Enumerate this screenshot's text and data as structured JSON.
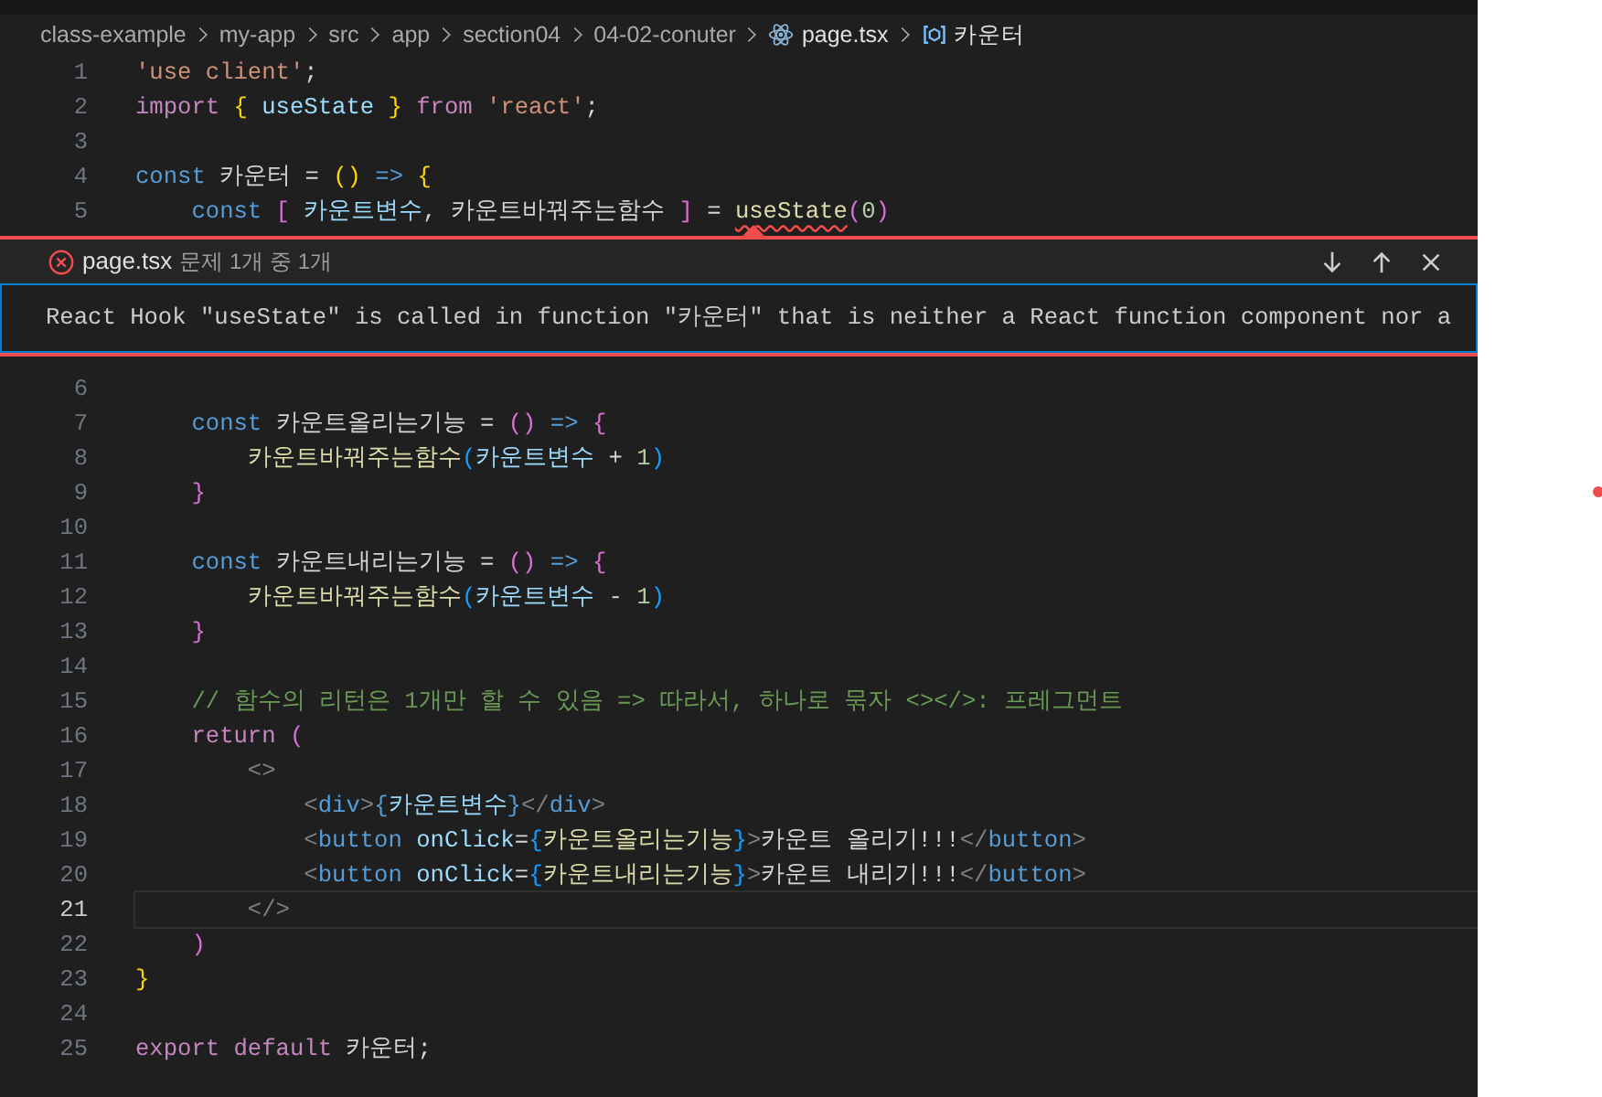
{
  "breadcrumb": [
    {
      "label": "class-example",
      "kind": "folder"
    },
    {
      "label": "my-app",
      "kind": "folder"
    },
    {
      "label": "src",
      "kind": "folder"
    },
    {
      "label": "app",
      "kind": "folder"
    },
    {
      "label": "section04",
      "kind": "folder"
    },
    {
      "label": "04-02-conuter",
      "kind": "folder"
    },
    {
      "label": "page.tsx",
      "kind": "file"
    },
    {
      "label": "카운터",
      "kind": "symbol"
    }
  ],
  "lines_before": [
    {
      "number": "1",
      "active": false,
      "tokens": [
        {
          "kind": "str",
          "text": "'use client'"
        },
        {
          "kind": "plain",
          "text": ";"
        }
      ]
    },
    {
      "number": "2",
      "active": false,
      "tokens": [
        {
          "kind": "ctl",
          "text": "import "
        },
        {
          "kind": "b1",
          "text": "{ "
        },
        {
          "kind": "var",
          "text": "useState "
        },
        {
          "kind": "b1",
          "text": "} "
        },
        {
          "kind": "ctl",
          "text": "from "
        },
        {
          "kind": "str",
          "text": "'react'"
        },
        {
          "kind": "plain",
          "text": ";"
        }
      ]
    },
    {
      "number": "3",
      "active": false
    },
    {
      "number": "4",
      "active": false,
      "tokens": [
        {
          "kind": "kw",
          "text": "const"
        },
        {
          "kind": "plain",
          "text": " 카운터 = "
        },
        {
          "kind": "b1",
          "text": "() "
        },
        {
          "kind": "kw",
          "text": "=> "
        },
        {
          "kind": "b1",
          "text": "{"
        }
      ]
    },
    {
      "number": "5",
      "active": false,
      "tokens": [
        {
          "kind": "kw",
          "text": "    const "
        },
        {
          "kind": "b2",
          "text": "[ "
        },
        {
          "kind": "var",
          "text": "카운트변수"
        },
        {
          "kind": "plain",
          "text": ", 카운트바꿔주는함수 "
        },
        {
          "kind": "b2",
          "text": "]"
        },
        {
          "kind": "plain",
          "text": " = "
        },
        {
          "kind": "err",
          "text": "useState"
        },
        {
          "kind": "b2",
          "text": "("
        },
        {
          "kind": "num",
          "text": "0"
        },
        {
          "kind": "b2",
          "text": ")"
        }
      ]
    }
  ],
  "problem": {
    "file": "page.tsx",
    "count": "문제 1개 중 1개",
    "message": "React Hook \"useState\" is called in function \"카운터\" that is neither a React function component nor a"
  },
  "lines_after": [
    {
      "number": "6",
      "active": false
    },
    {
      "number": "7",
      "active": false,
      "tokens": [
        {
          "kind": "kw",
          "text": "    const"
        },
        {
          "kind": "plain",
          "text": " 카운트올리는기능 = "
        },
        {
          "kind": "b2",
          "text": "() "
        },
        {
          "kind": "kw",
          "text": "=> "
        },
        {
          "kind": "b2",
          "text": "{"
        }
      ]
    },
    {
      "number": "8",
      "active": false,
      "tokens": [
        {
          "kind": "fn",
          "text": "        카운트바꿔주는함수"
        },
        {
          "kind": "b3",
          "text": "("
        },
        {
          "kind": "var",
          "text": "카운트변수"
        },
        {
          "kind": "plain",
          "text": " + "
        },
        {
          "kind": "num",
          "text": "1"
        },
        {
          "kind": "b3",
          "text": ")"
        }
      ]
    },
    {
      "number": "9",
      "active": false,
      "tokens": [
        {
          "kind": "b2",
          "text": "    }"
        }
      ]
    },
    {
      "number": "10",
      "active": false
    },
    {
      "number": "11",
      "active": false,
      "tokens": [
        {
          "kind": "kw",
          "text": "    const"
        },
        {
          "kind": "plain",
          "text": " 카운트내리는기능 = "
        },
        {
          "kind": "b2",
          "text": "() "
        },
        {
          "kind": "kw",
          "text": "=> "
        },
        {
          "kind": "b2",
          "text": "{"
        }
      ]
    },
    {
      "number": "12",
      "active": false,
      "tokens": [
        {
          "kind": "fn",
          "text": "        카운트바꿔주는함수"
        },
        {
          "kind": "b3",
          "text": "("
        },
        {
          "kind": "var",
          "text": "카운트변수"
        },
        {
          "kind": "plain",
          "text": " - "
        },
        {
          "kind": "num",
          "text": "1"
        },
        {
          "kind": "b3",
          "text": ")"
        }
      ]
    },
    {
      "number": "13",
      "active": false,
      "tokens": [
        {
          "kind": "b2",
          "text": "    }"
        }
      ]
    },
    {
      "number": "14",
      "active": false
    },
    {
      "number": "15",
      "active": false,
      "tokens": [
        {
          "kind": "comment",
          "text": "    // 함수의 리턴은 1개만 할 수 있음 => 따라서, 하나로 묶자 <></>: 프레그먼트"
        }
      ]
    },
    {
      "number": "16",
      "active": false,
      "tokens": [
        {
          "kind": "ctl",
          "text": "    return "
        },
        {
          "kind": "b2",
          "text": "("
        }
      ]
    },
    {
      "number": "17",
      "active": false,
      "tokens": [
        {
          "kind": "punct",
          "text": "        <>"
        }
      ]
    },
    {
      "number": "18",
      "active": false,
      "tokens": [
        {
          "kind": "punct",
          "text": "            <"
        },
        {
          "kind": "kw",
          "text": "div"
        },
        {
          "kind": "punct",
          "text": ">"
        },
        {
          "kind": "kw",
          "text": "{"
        },
        {
          "kind": "var",
          "text": "카운트변수"
        },
        {
          "kind": "kw",
          "text": "}"
        },
        {
          "kind": "punct",
          "text": "</"
        },
        {
          "kind": "kw",
          "text": "div"
        },
        {
          "kind": "punct",
          "text": ">"
        }
      ]
    },
    {
      "number": "19",
      "active": false,
      "tokens": [
        {
          "kind": "punct",
          "text": "            <"
        },
        {
          "kind": "kw",
          "text": "button "
        },
        {
          "kind": "var",
          "text": "onClick"
        },
        {
          "kind": "plain",
          "text": "="
        },
        {
          "kind": "b3",
          "text": "{"
        },
        {
          "kind": "fn",
          "text": "카운트올리는기능"
        },
        {
          "kind": "b3",
          "text": "}"
        },
        {
          "kind": "punct",
          "text": ">"
        },
        {
          "kind": "plain",
          "text": "카운트 올리기!!!"
        },
        {
          "kind": "punct",
          "text": "</"
        },
        {
          "kind": "kw",
          "text": "button"
        },
        {
          "kind": "punct",
          "text": ">"
        }
      ]
    },
    {
      "number": "20",
      "active": false,
      "tokens": [
        {
          "kind": "punct",
          "text": "            <"
        },
        {
          "kind": "kw",
          "text": "button "
        },
        {
          "kind": "var",
          "text": "onClick"
        },
        {
          "kind": "plain",
          "text": "="
        },
        {
          "kind": "b3",
          "text": "{"
        },
        {
          "kind": "fn",
          "text": "카운트내리는기능"
        },
        {
          "kind": "b3",
          "text": "}"
        },
        {
          "kind": "punct",
          "text": ">"
        },
        {
          "kind": "plain",
          "text": "카운트 내리기!!!"
        },
        {
          "kind": "punct",
          "text": "</"
        },
        {
          "kind": "kw",
          "text": "button"
        },
        {
          "kind": "punct",
          "text": ">"
        }
      ]
    },
    {
      "number": "21",
      "active": true,
      "tokens": [
        {
          "kind": "punct",
          "text": "        </>"
        }
      ]
    },
    {
      "number": "22",
      "active": false,
      "tokens": [
        {
          "kind": "b2",
          "text": "    )"
        }
      ]
    },
    {
      "number": "23",
      "active": false,
      "tokens": [
        {
          "kind": "b1",
          "text": "}"
        }
      ]
    },
    {
      "number": "24",
      "active": false
    },
    {
      "number": "25",
      "active": false,
      "tokens": [
        {
          "kind": "ctl",
          "text": "export default"
        },
        {
          "kind": "plain",
          "text": " 카운터;"
        }
      ]
    }
  ]
}
